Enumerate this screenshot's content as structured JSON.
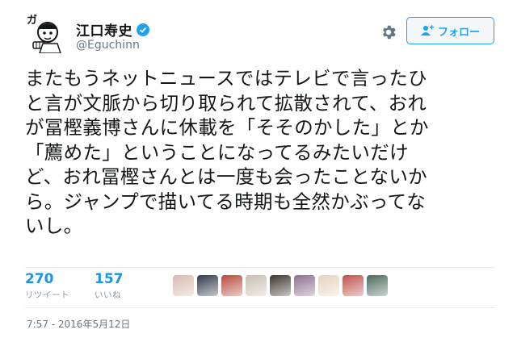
{
  "user": {
    "display_name": "江口寿史",
    "handle": "@Eguchinn",
    "avatar_text": "ガ"
  },
  "actions": {
    "follow_label": "フォロー"
  },
  "tweet": {
    "lines": [
      "またもうネットニュースではテレビで言ったひ",
      "と言が文脈から切り取られて拡散されて、おれ",
      "が冨樫義博さんに休載を「そそのかした」とか",
      "「薦めた」ということになってるみたいだけ",
      "ど、おれ冨樫さんとは一度も会ったことないか",
      "ら。ジャンプで描いてる時期も全然かぶってな",
      "いし。"
    ]
  },
  "stats": {
    "retweets": {
      "count": "270",
      "label": "リツイート"
    },
    "likes": {
      "count": "157",
      "label": "いいね"
    }
  },
  "likers": [
    {
      "name": "liker-1",
      "color": "#d9b8b0"
    },
    {
      "name": "liker-2",
      "color": "#2f3a4a"
    },
    {
      "name": "liker-3",
      "color": "#b84a3c"
    },
    {
      "name": "liker-4",
      "color": "#c9bfb0"
    },
    {
      "name": "liker-5",
      "color": "#3d352c"
    },
    {
      "name": "liker-6",
      "color": "#8c6f8e"
    },
    {
      "name": "liker-7",
      "color": "#e7d3c0"
    },
    {
      "name": "liker-8",
      "color": "#c0504a"
    },
    {
      "name": "liker-9",
      "color": "#4a6a5a"
    }
  ],
  "timestamp": "7:57 - 2016年5月12日",
  "colors": {
    "accent": "#1da1f2",
    "text": "#14171a",
    "muted": "#657786"
  }
}
